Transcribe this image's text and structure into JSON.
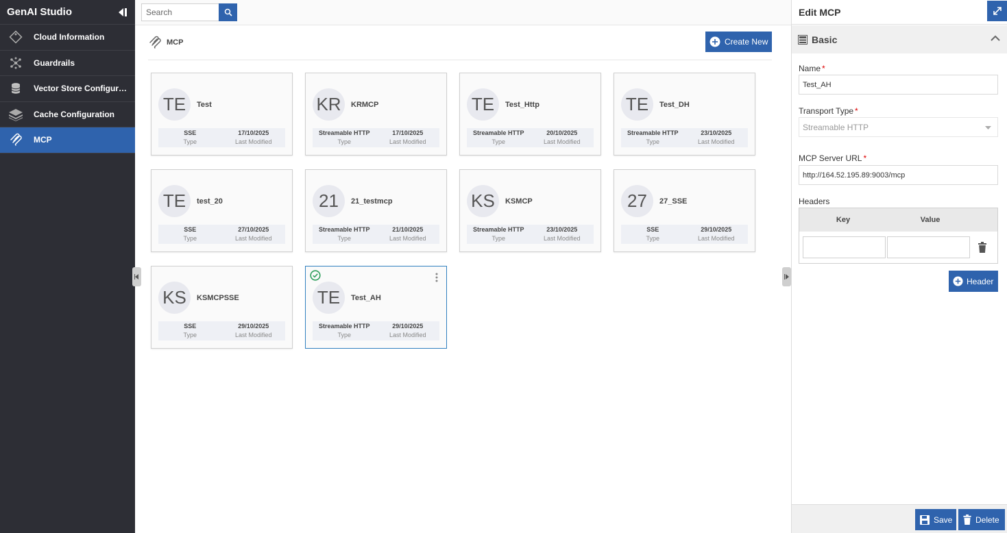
{
  "app": {
    "title": "GenAI Studio"
  },
  "sidebar": {
    "items": [
      {
        "label": "Cloud Information",
        "icon": "tag-icon",
        "active": false
      },
      {
        "label": "Guardrails",
        "icon": "network-icon",
        "active": false
      },
      {
        "label": "Vector Store Configurat...",
        "icon": "database-icon",
        "active": false
      },
      {
        "label": "Cache Configuration",
        "icon": "layers-icon",
        "active": false
      },
      {
        "label": "MCP",
        "icon": "mcp-icon",
        "active": true
      }
    ]
  },
  "search": {
    "placeholder": "Search"
  },
  "page": {
    "title": "MCP",
    "create_label": "Create New"
  },
  "cards": [
    {
      "initials": "TE",
      "name": "Test",
      "type": "SSE",
      "date": "17/10/2025",
      "type_label": "Type",
      "date_label": "Last Modified"
    },
    {
      "initials": "KR",
      "name": "KRMCP",
      "type": "Streamable HTTP",
      "date": "17/10/2025",
      "type_label": "Type",
      "date_label": "Last Modified"
    },
    {
      "initials": "TE",
      "name": "Test_Http",
      "type": "Streamable HTTP",
      "date": "20/10/2025",
      "type_label": "Type",
      "date_label": "Last Modified"
    },
    {
      "initials": "TE",
      "name": "Test_DH",
      "type": "Streamable HTTP",
      "date": "23/10/2025",
      "type_label": "Type",
      "date_label": "Last Modified"
    },
    {
      "initials": "TE",
      "name": "test_20",
      "type": "SSE",
      "date": "27/10/2025",
      "type_label": "Type",
      "date_label": "Last Modified"
    },
    {
      "initials": "21",
      "name": "21_testmcp",
      "type": "Streamable HTTP",
      "date": "21/10/2025",
      "type_label": "Type",
      "date_label": "Last Modified"
    },
    {
      "initials": "KS",
      "name": "KSMCP",
      "type": "Streamable HTTP",
      "date": "23/10/2025",
      "type_label": "Type",
      "date_label": "Last Modified"
    },
    {
      "initials": "27",
      "name": "27_SSE",
      "type": "SSE",
      "date": "29/10/2025",
      "type_label": "Type",
      "date_label": "Last Modified"
    },
    {
      "initials": "KS",
      "name": "KSMCPSSE",
      "type": "SSE",
      "date": "29/10/2025",
      "type_label": "Type",
      "date_label": "Last Modified"
    },
    {
      "initials": "TE",
      "name": "Test_AH",
      "type": "Streamable HTTP",
      "date": "29/10/2025",
      "type_label": "Type",
      "date_label": "Last Modified",
      "selected": true
    }
  ],
  "panel": {
    "title": "Edit MCP",
    "section": "Basic",
    "name_label": "Name",
    "name_value": "Test_AH",
    "transport_label": "Transport Type",
    "transport_value": "Streamable HTTP",
    "url_label": "MCP Server URL",
    "url_value": "http://164.52.195.89:9003/mcp",
    "headers_label": "Headers",
    "key_col": "Key",
    "value_col": "Value",
    "add_header_label": "Header",
    "save_label": "Save",
    "delete_label": "Delete"
  },
  "colors": {
    "accent": "#2f63ad",
    "sidebar_bg": "#2d2e35",
    "success": "#2e9e5b"
  }
}
